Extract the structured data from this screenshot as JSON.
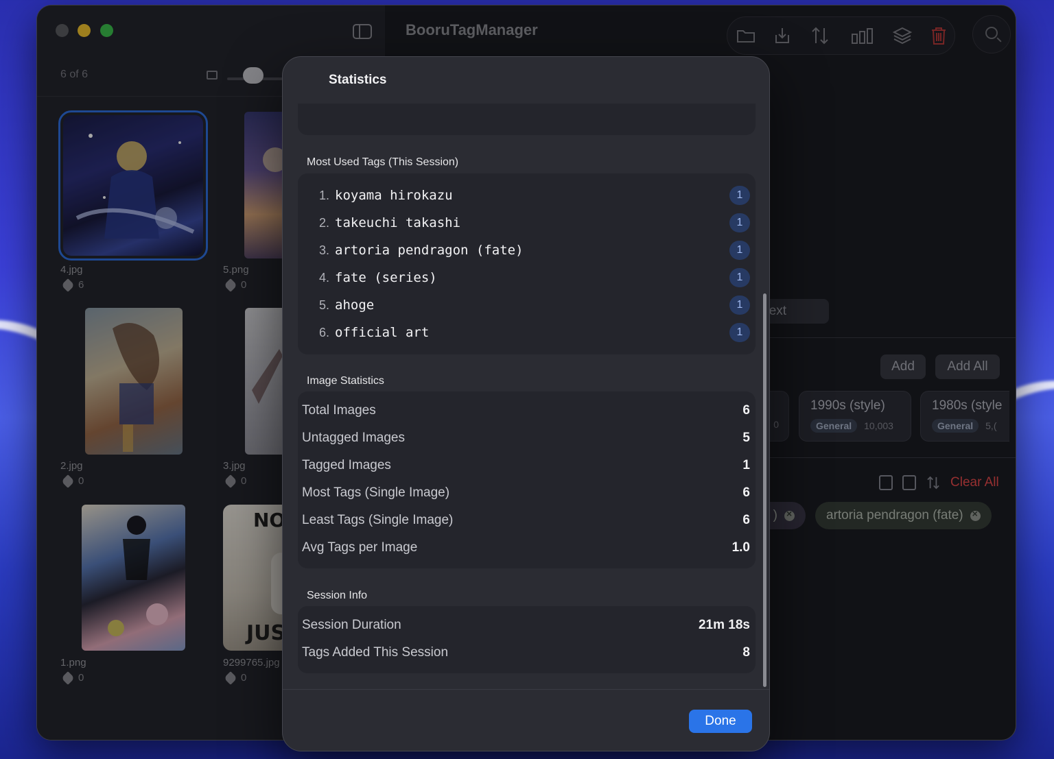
{
  "app": {
    "title": "BooruTagManager"
  },
  "sidebar": {
    "count_label": "6 of 6",
    "thumbnails": [
      {
        "name": "4.jpg",
        "tags": "6"
      },
      {
        "name": "5.png",
        "tags": "0"
      },
      {
        "name": "2.jpg",
        "tags": "0"
      },
      {
        "name": "3.jpg",
        "tags": "0"
      },
      {
        "name": "1.png",
        "tags": "0"
      },
      {
        "name": "9299765.jpg",
        "tags": "0"
      }
    ],
    "meme_text": {
      "top": "NO",
      "bottom": "JUST"
    }
  },
  "toolbar": {
    "icons": [
      "folder-icon",
      "import-icon",
      "sort-icon",
      "chart-icon",
      "layers-icon",
      "trash-icon",
      "search-icon"
    ]
  },
  "main": {
    "next_label": "Next",
    "add_label": "Add",
    "add_all_label": "Add All",
    "clear_all_label": "Clear All",
    "suggestions": [
      {
        "title": "1990s (style)",
        "category": "General",
        "count": "10,003"
      },
      {
        "title": "1980s (style",
        "category": "General",
        "count": "5,("
      }
    ],
    "partial_left_count": "0",
    "chips": [
      {
        "label": ")"
      },
      {
        "label": "artoria pendragon (fate)"
      }
    ]
  },
  "modal": {
    "title": "Statistics",
    "most_used_header": "Most Used Tags (This Session)",
    "most_used": [
      {
        "rank": "1.",
        "tag": "koyama hirokazu",
        "count": "1"
      },
      {
        "rank": "2.",
        "tag": "takeuchi takashi",
        "count": "1"
      },
      {
        "rank": "3.",
        "tag": "artoria pendragon (fate)",
        "count": "1"
      },
      {
        "rank": "4.",
        "tag": "fate (series)",
        "count": "1"
      },
      {
        "rank": "5.",
        "tag": "ahoge",
        "count": "1"
      },
      {
        "rank": "6.",
        "tag": "official art",
        "count": "1"
      }
    ],
    "image_stats_header": "Image Statistics",
    "image_stats": [
      {
        "label": "Total Images",
        "value": "6"
      },
      {
        "label": "Untagged Images",
        "value": "5"
      },
      {
        "label": "Tagged Images",
        "value": "1"
      },
      {
        "label": "Most Tags (Single Image)",
        "value": "6"
      },
      {
        "label": "Least Tags (Single Image)",
        "value": "6"
      },
      {
        "label": "Avg Tags per Image",
        "value": "1.0"
      }
    ],
    "session_header": "Session Info",
    "session": [
      {
        "label": "Session Duration",
        "value": "21m 18s"
      },
      {
        "label": "Tags Added This Session",
        "value": "8"
      }
    ],
    "done_label": "Done"
  },
  "colors": {
    "accent": "#2a74e8",
    "destructive": "#c43a3a",
    "badge_bg": "#273a63",
    "traffic_close": "#5b5c61",
    "traffic_min": "#f3c42f",
    "traffic_max": "#3cc14e"
  }
}
